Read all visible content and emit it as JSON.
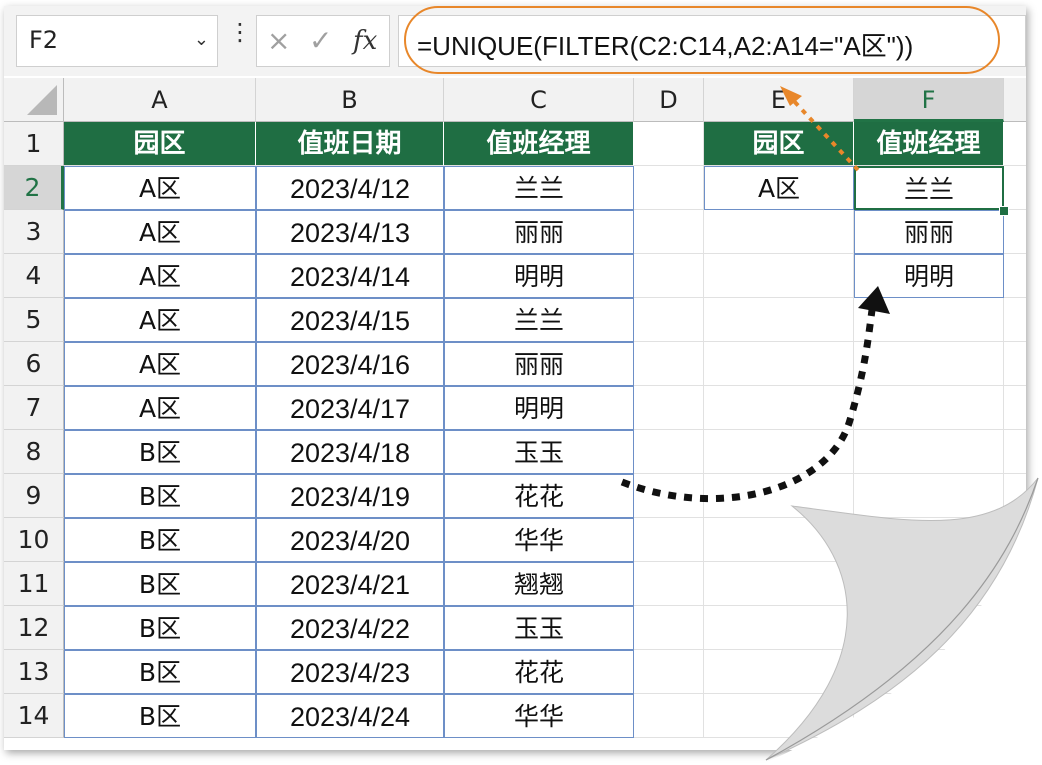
{
  "formula_bar": {
    "name_box": "F2",
    "cancel_icon": "×",
    "enter_icon": "✓",
    "fx_label": "fx",
    "formula": "=UNIQUE(FILTER(C2:C14,A2:A14=\"A区\"))"
  },
  "columns": [
    "A",
    "B",
    "C",
    "D",
    "E",
    "F"
  ],
  "rows": [
    "1",
    "2",
    "3",
    "4",
    "5",
    "6",
    "7",
    "8",
    "9",
    "10",
    "11",
    "12",
    "13",
    "14"
  ],
  "table_left": {
    "headers": [
      "园区",
      "值班日期",
      "值班经理"
    ],
    "data": [
      [
        "A区",
        "2023/4/12",
        "兰兰"
      ],
      [
        "A区",
        "2023/4/13",
        "丽丽"
      ],
      [
        "A区",
        "2023/4/14",
        "明明"
      ],
      [
        "A区",
        "2023/4/15",
        "兰兰"
      ],
      [
        "A区",
        "2023/4/16",
        "丽丽"
      ],
      [
        "A区",
        "2023/4/17",
        "明明"
      ],
      [
        "B区",
        "2023/4/18",
        "玉玉"
      ],
      [
        "B区",
        "2023/4/19",
        "花花"
      ],
      [
        "B区",
        "2023/4/20",
        "华华"
      ],
      [
        "B区",
        "2023/4/21",
        "翘翘"
      ],
      [
        "B区",
        "2023/4/22",
        "玉玉"
      ],
      [
        "B区",
        "2023/4/23",
        "花花"
      ],
      [
        "B区",
        "2023/4/24",
        "华华"
      ]
    ]
  },
  "table_right": {
    "headers": [
      "园区",
      "值班经理"
    ],
    "criteria": "A区",
    "results": [
      "兰兰",
      "丽丽",
      "明明"
    ]
  },
  "colors": {
    "header_green": "#1f6e43",
    "border_blue": "#6d8fc7",
    "highlight_orange": "#e8872a"
  }
}
